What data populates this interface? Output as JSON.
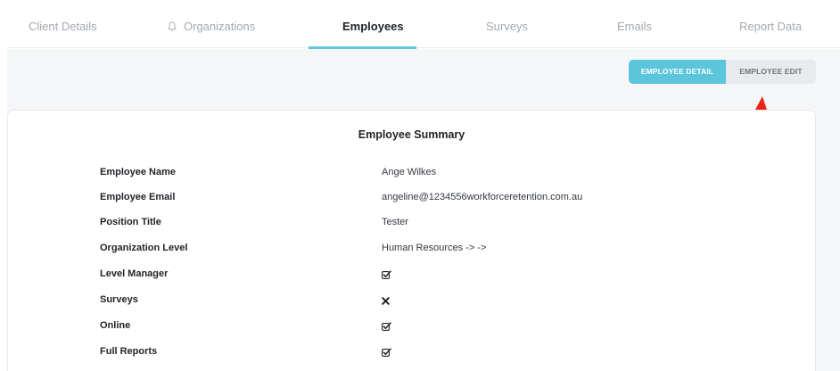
{
  "tabs": [
    {
      "label": "Client Details",
      "active": false
    },
    {
      "label": "Organizations",
      "active": false,
      "icon": "bell-icon"
    },
    {
      "label": "Employees",
      "active": true
    },
    {
      "label": "Surveys",
      "active": false
    },
    {
      "label": "Emails",
      "active": false
    },
    {
      "label": "Report Data",
      "active": false
    }
  ],
  "actions": {
    "detail_label": "EMPLOYEE DETAIL",
    "edit_label": "EMPLOYEE EDIT"
  },
  "summary": {
    "title": "Employee Summary",
    "rows": [
      {
        "label": "Employee Name",
        "value": "Ange Wilkes"
      },
      {
        "label": "Employee Email",
        "value": "angeline@1234556workforceretention.com.au"
      },
      {
        "label": "Position Title",
        "value": "Tester"
      },
      {
        "label": "Organization Level",
        "value": "Human Resources -> ->"
      },
      {
        "label": "Level Manager",
        "icon": "checked-box-icon"
      },
      {
        "label": "Surveys",
        "icon": "x-icon"
      },
      {
        "label": "Online",
        "icon": "checked-box-icon"
      },
      {
        "label": "Full Reports",
        "icon": "checked-box-icon"
      }
    ]
  },
  "colors": {
    "accent": "#5bc5dc",
    "annotation": "#e8241a"
  }
}
